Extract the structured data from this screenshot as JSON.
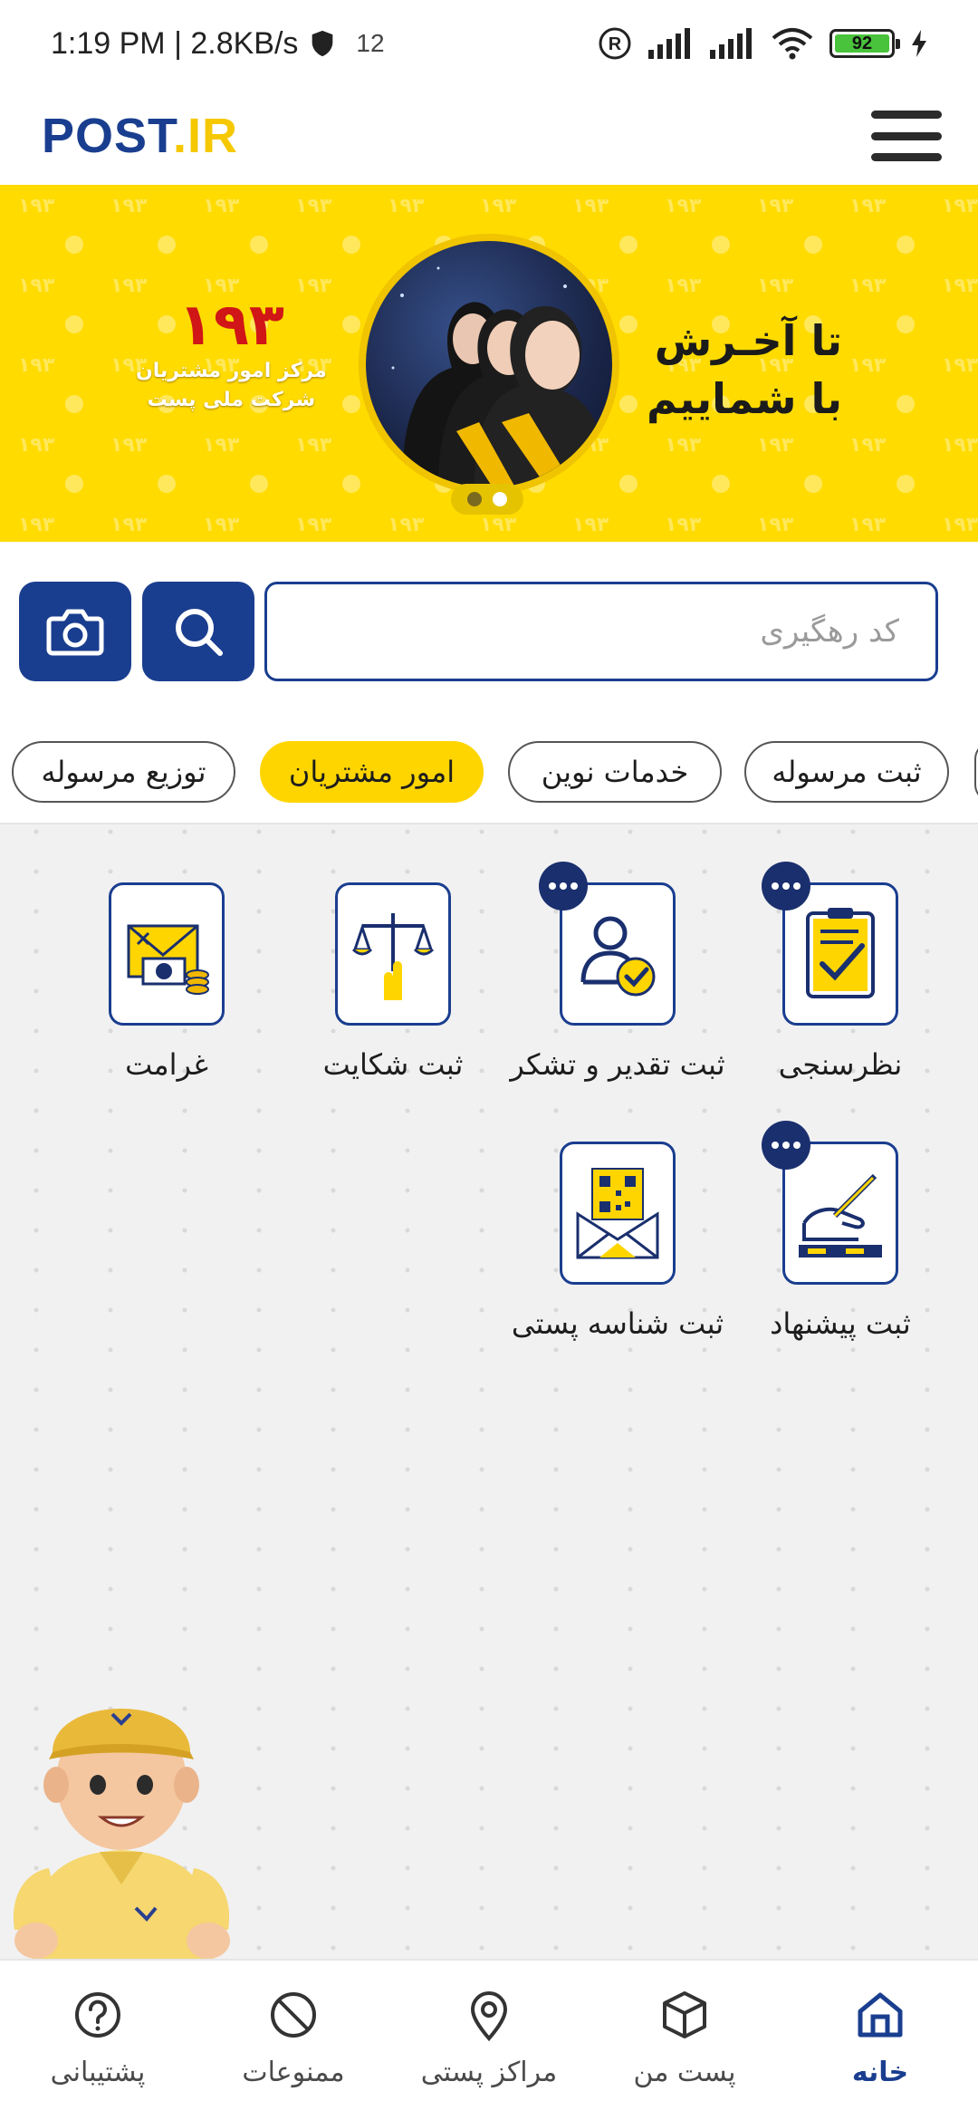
{
  "status_bar": {
    "time_speed": "1:19 PM | 2.8KB/s",
    "notif_count": "12",
    "battery": "92"
  },
  "header": {
    "logo_part1": "POST",
    "logo_part2": ".IR"
  },
  "banner": {
    "title_line1": "تا آخـرش",
    "title_line2": "با شماییم",
    "number": "۱۹۳",
    "sub_line1": "مرکز امور مشتریان",
    "sub_line2": "شرکت ملی پست",
    "pattern_text": "۱۹۳"
  },
  "search": {
    "placeholder": "کد رهگیری"
  },
  "tabs": [
    {
      "label": "ثبت مرسوله"
    },
    {
      "label": "خدمات نوین"
    },
    {
      "label": "امور مشتریان"
    },
    {
      "label": "توزیع مرسوله"
    }
  ],
  "services": [
    {
      "label": "نظرسنجی"
    },
    {
      "label": "ثبت تقدیر و تشکر"
    },
    {
      "label": "ثبت شکایت"
    },
    {
      "label": "غرامت"
    },
    {
      "label": "ثبت پیشنهاد"
    },
    {
      "label": "ثبت شناسه پستی"
    }
  ],
  "bottom_nav": [
    {
      "label": "خانه"
    },
    {
      "label": "پست من"
    },
    {
      "label": "مراکز پستی"
    },
    {
      "label": "ممنوعات"
    },
    {
      "label": "پشتیبانی"
    }
  ],
  "colors": {
    "brand_blue": "#1a3e8f",
    "brand_yellow": "#ffd500"
  }
}
